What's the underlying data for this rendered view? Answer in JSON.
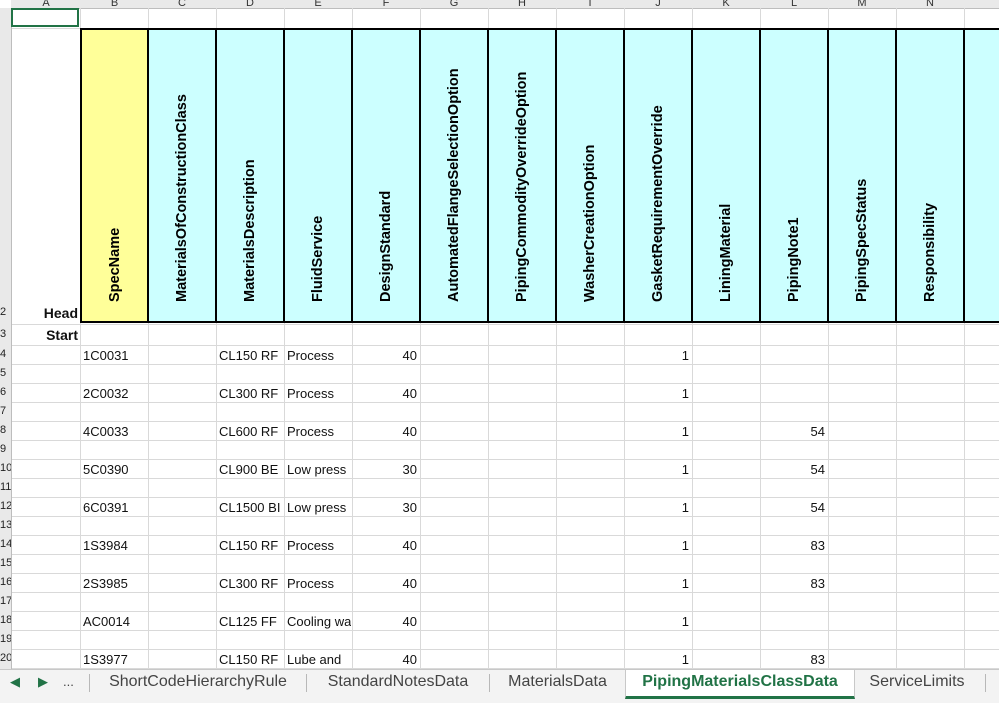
{
  "sheet": {
    "columns": [
      "A",
      "B",
      "C",
      "D",
      "E",
      "F",
      "G",
      "H",
      "I",
      "J",
      "K",
      "L",
      "M",
      "N"
    ],
    "row_numbers": [
      "2",
      "3",
      "4",
      "5",
      "6",
      "7",
      "8",
      "9",
      "10",
      "11",
      "12",
      "13",
      "14",
      "15",
      "16",
      "17",
      "18",
      "19",
      "20"
    ],
    "side_labels": {
      "head": "Head",
      "start": "Start"
    },
    "headers": [
      "SpecName",
      "MaterialsOfConstructionClass",
      "MaterialsDescription",
      "FluidService",
      "DesignStandard",
      "AutomatedFlangeSelectionOption",
      "PipingCommodityOverrideOption",
      "WasherCreationOption",
      "GasketRequirementOverride",
      "LiningMaterial",
      "PipingNote1",
      "PipingSpecStatus",
      "Responsibility"
    ],
    "rows": [
      {
        "spec": "1C0031",
        "desc": "CL150 RF",
        "fluid": "Process",
        "std": "40",
        "gasket": "1",
        "note": ""
      },
      {
        "spec": "2C0032",
        "desc": "CL300 RF",
        "fluid": "Process",
        "std": "40",
        "gasket": "1",
        "note": ""
      },
      {
        "spec": "4C0033",
        "desc": "CL600 RF",
        "fluid": "Process",
        "std": "40",
        "gasket": "1",
        "note": "54"
      },
      {
        "spec": "5C0390",
        "desc": "CL900 BE",
        "fluid": "Low press",
        "std": "30",
        "gasket": "1",
        "note": "54"
      },
      {
        "spec": "6C0391",
        "desc": "CL1500 BI",
        "fluid": "Low press",
        "std": "30",
        "gasket": "1",
        "note": "54"
      },
      {
        "spec": "1S3984",
        "desc": "CL150 RF",
        "fluid": "Process",
        "std": "40",
        "gasket": "1",
        "note": "83"
      },
      {
        "spec": "2S3985",
        "desc": "CL300 RF",
        "fluid": "Process",
        "std": "40",
        "gasket": "1",
        "note": "83"
      },
      {
        "spec": "AC0014",
        "desc": "CL125 FF",
        "fluid": "Cooling wa",
        "std": "40",
        "gasket": "1",
        "note": ""
      },
      {
        "spec": "1S3977",
        "desc": "CL150 RF",
        "fluid": "Lube and",
        "std": "40",
        "gasket": "1",
        "note": "83"
      }
    ]
  },
  "tabs": {
    "nav_prev": "◀",
    "nav_next": "▶",
    "nav_more": "...",
    "items": [
      "ShortCodeHierarchyRule",
      "StandardNotesData",
      "MaterialsData",
      "PipingMaterialsClassData",
      "ServiceLimits"
    ],
    "active": "PipingMaterialsClassData"
  },
  "colors": {
    "specname_header": "#ffff99",
    "other_headers": "#ccffff",
    "active_tab": "#217346"
  }
}
